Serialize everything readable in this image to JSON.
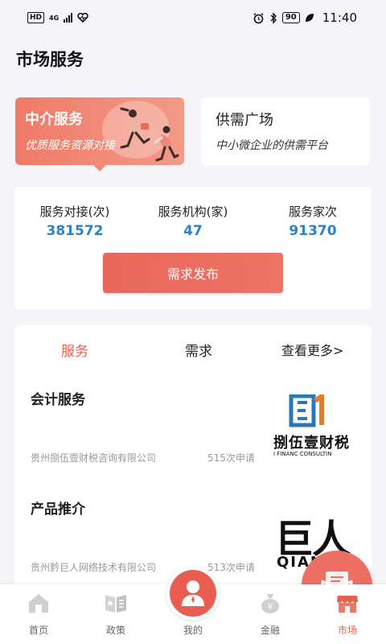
{
  "status_bar": {
    "left_badge": "HD",
    "network": "4G",
    "battery": "90",
    "time": "11:40"
  },
  "page_title": "市场服务",
  "agent_card": {
    "title": "中介服务",
    "subtitle": "优质服务资源对接"
  },
  "supply_card": {
    "title": "供需广场",
    "subtitle": "中小微企业的供需平台"
  },
  "stats": [
    {
      "label": "服务对接(次)",
      "value": "381572"
    },
    {
      "label": "服务机构(家)",
      "value": "47"
    },
    {
      "label": "服务家次",
      "value": "91370"
    }
  ],
  "publish_button": "需求发布",
  "tabs": {
    "service": "服务",
    "demand": "需求",
    "more": "查看更多>"
  },
  "items": [
    {
      "title": "会计服务",
      "company": "贵州捌伍壹财税咨询有限公司",
      "count": "515次申请",
      "logo_text": "捌伍壹财税",
      "logo_sub": "I FINANC CONSULTIN"
    },
    {
      "title": "产品推介",
      "company": "贵州黔巨人网络技术有限公司",
      "count": "513次申请",
      "logo_text": "巨人",
      "logo_sub": "QIAN"
    }
  ],
  "nav": [
    {
      "label": "首页",
      "icon": "home-icon"
    },
    {
      "label": "政策",
      "icon": "policy-book-icon"
    },
    {
      "label": "我的",
      "icon": "user-icon"
    },
    {
      "label": "金融",
      "icon": "money-bag-icon"
    },
    {
      "label": "市场",
      "icon": "market-store-icon"
    }
  ],
  "colors": {
    "accent": "#e6604f",
    "value_blue": "#2a82c9",
    "button": "#ea6558"
  }
}
